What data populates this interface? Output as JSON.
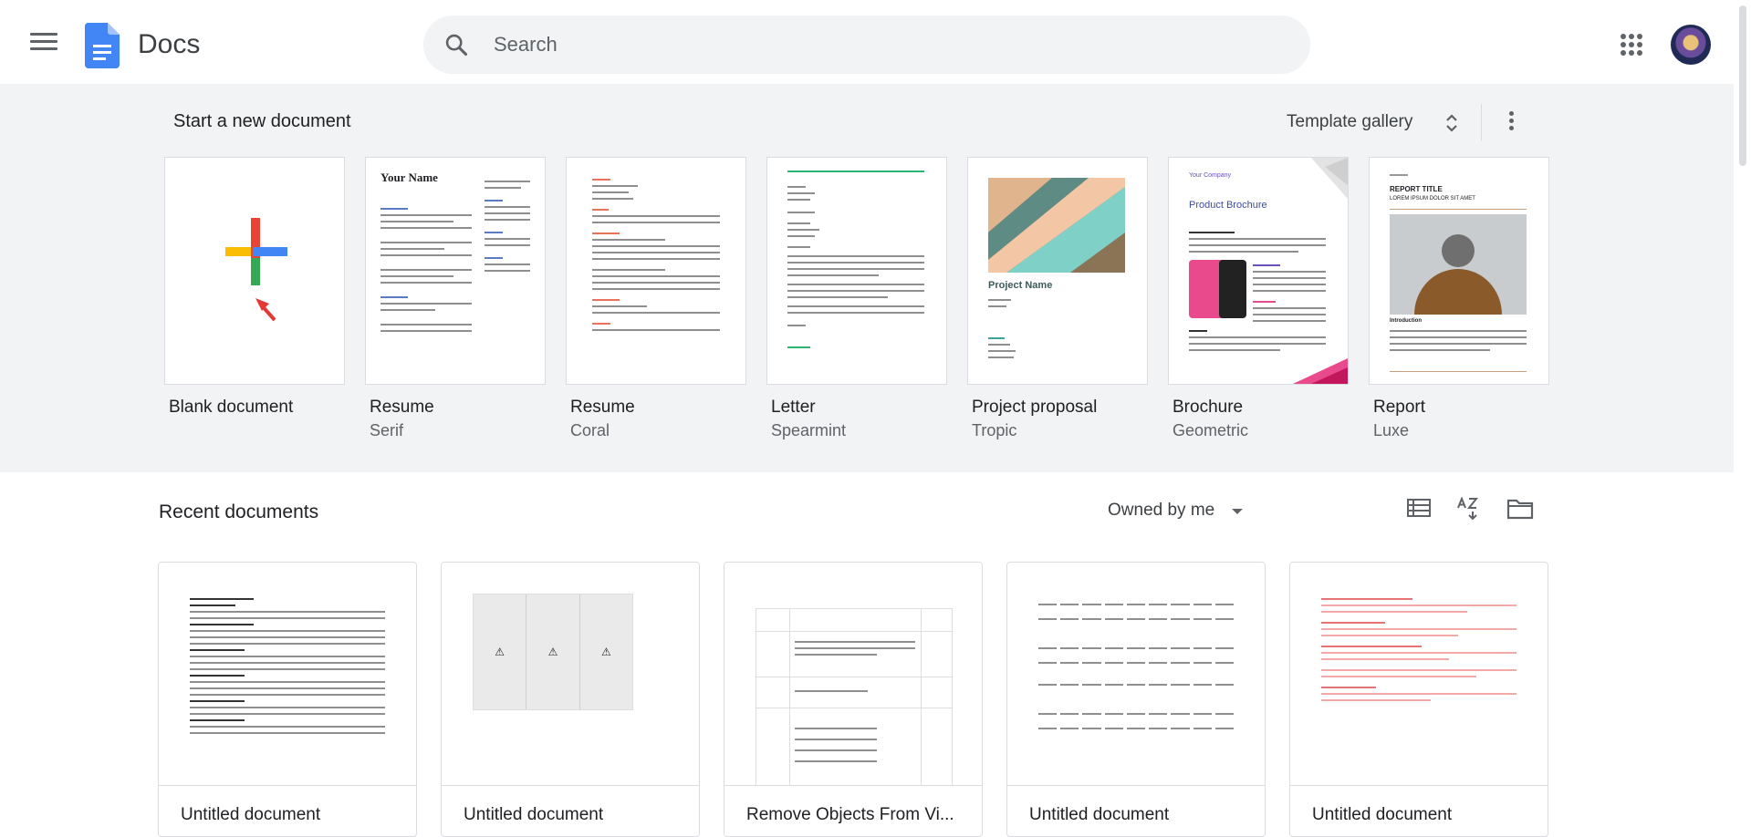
{
  "header": {
    "app_title": "Docs",
    "search_placeholder": "Search"
  },
  "templates_section": {
    "title": "Start a new document",
    "gallery_label": "Template gallery",
    "items": [
      {
        "name": "Blank document",
        "sub": ""
      },
      {
        "name": "Resume",
        "sub": "Serif",
        "preview_heading": "Your Name"
      },
      {
        "name": "Resume",
        "sub": "Coral"
      },
      {
        "name": "Letter",
        "sub": "Spearmint"
      },
      {
        "name": "Project proposal",
        "sub": "Tropic",
        "preview_heading": "Project Name"
      },
      {
        "name": "Brochure",
        "sub": "Geometric",
        "preview_small": "Your Company",
        "preview_heading": "Product Brochure"
      },
      {
        "name": "Report",
        "sub": "Luxe",
        "preview_heading": "REPORT TITLE",
        "preview_subheading": "LOREM IPSUM DOLOR SIT AMET",
        "preview_small": "Introduction"
      }
    ]
  },
  "recent_section": {
    "title": "Recent documents",
    "owner_filter": "Owned by me",
    "documents": [
      {
        "name": "Untitled document"
      },
      {
        "name": "Untitled document"
      },
      {
        "name": "Remove Objects From Vi..."
      },
      {
        "name": "Untitled document"
      },
      {
        "name": "Untitled document"
      }
    ]
  },
  "colors": {
    "docs_blue": "#4285f4",
    "templates_bg": "#f1f3f4",
    "plus_red": "#ea4335",
    "plus_yellow": "#fbbc04",
    "plus_green": "#34a853",
    "plus_blue": "#4285f4"
  },
  "icons": [
    "menu-icon",
    "docs-logo-icon",
    "search-icon",
    "apps-icon",
    "unfold-icon",
    "more-vert-icon",
    "list-view-icon",
    "sort-az-icon",
    "folder-icon"
  ]
}
